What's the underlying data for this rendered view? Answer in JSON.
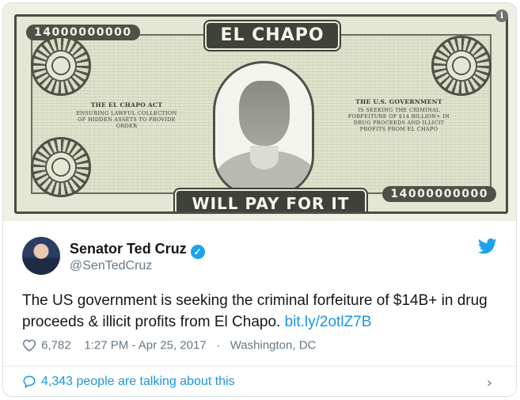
{
  "media": {
    "serial_top": "14000000000",
    "serial_bottom": "14000000000",
    "banner_top": "EL CHAPO",
    "banner_bottom": "WILL PAY FOR IT",
    "seal_left_title": "THE EL CHAPO ACT",
    "seal_left_body": "ENSURING LAWFUL COLLECTION OF HIDDEN ASSETS TO PROVIDE ORDER",
    "seal_right_title": "THE U.S. GOVERNMENT",
    "seal_right_body": "IS SEEKING THE CRIMINAL FORFEITURE OF $14 BILLION+ IN DRUG PROCEEDS AND ILLICIT PROFITS FROM EL CHAPO",
    "info_icon": "i"
  },
  "tweet": {
    "author_name": "Senator Ted Cruz",
    "handle": "@SenTedCruz",
    "text": "The US government is seeking the criminal forfeiture of $14B+ in drug proceeds & illicit profits from El Chapo.",
    "link": "bit.ly/2otlZ7B",
    "likes": "6,782",
    "timestamp": "1:27 PM - Apr 25, 2017",
    "separator": "·",
    "location": "Washington, DC",
    "talking": "4,343 people are talking about this"
  },
  "icons": {
    "verified": "verified-badge-icon",
    "bird": "twitter-bird-icon",
    "heart": "heart-icon",
    "bubble": "speech-bubble-icon",
    "chevron": "chevron-right-icon"
  },
  "colors": {
    "link": "#1b95e0",
    "verified": "#1da1f2",
    "text": "#14171a",
    "muted": "#657786"
  }
}
